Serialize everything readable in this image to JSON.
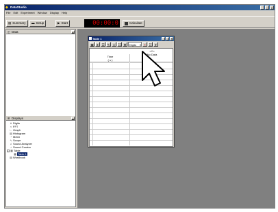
{
  "app": {
    "title": "DataStudio"
  },
  "menu": [
    "File",
    "Edit",
    "Experiment",
    "Window",
    "Display",
    "Help"
  ],
  "toolbar": {
    "summary_label": "Summary",
    "setup_label": "Setup",
    "start_label": "Start",
    "timer_value": "00:00:0",
    "calculate_label": "Calculate"
  },
  "left_panel": {
    "data_combo": "Data",
    "displays_combo": "Displays",
    "tree": [
      {
        "label": "Digits",
        "icon": "digits-icon"
      },
      {
        "label": "FFT",
        "icon": "fft-icon"
      },
      {
        "label": "Graph",
        "icon": "graph-icon"
      },
      {
        "label": "Histogram",
        "icon": "histogram-icon"
      },
      {
        "label": "Meter",
        "icon": "meter-icon"
      },
      {
        "label": "Scope",
        "icon": "scope-icon"
      },
      {
        "label": "Sound Analyzer",
        "icon": "sound-analyzer-icon"
      },
      {
        "label": "Sound Creator",
        "icon": "sound-creator-icon"
      },
      {
        "label": "Table",
        "icon": "table-icon"
      },
      {
        "label": "Table 1",
        "icon": "table-doc-icon",
        "selected": true
      },
      {
        "label": "Workbook",
        "icon": "workbook-icon"
      }
    ]
  },
  "table_window": {
    "title": "Table 1",
    "digits_label": "Digits",
    "column_header": "<Y>",
    "column_sub": "No Data",
    "time_label": "Time",
    "time_unit": "( s )"
  },
  "colors": {
    "titlebar": "#0a246a",
    "mdi_bg": "#808080",
    "timer_text": "#d00000"
  }
}
